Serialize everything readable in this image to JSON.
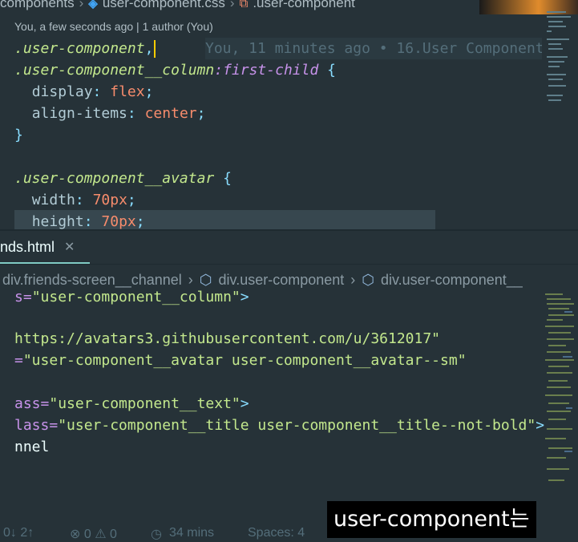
{
  "breadcrumb_top": {
    "folder": "components",
    "file": "user-component.css",
    "symbol": ".user-component"
  },
  "codelens_top": "You, a few seconds ago | 1 author (You)",
  "blame": "You, 11 minutes ago • 16.User Component",
  "top_code": {
    "l1_sel": ".user-component",
    "l1_punc": ",",
    "l2_sel": ".user-component__column",
    "l2_pseudo": ":first-child",
    "l2_brace": "{",
    "l3_prop": "display",
    "l3_val": "flex",
    "l4_prop": "align-items",
    "l4_val": "center",
    "l5_brace": "}",
    "l7_sel": ".user-component__avatar",
    "l7_brace": "{",
    "l8_prop": "width",
    "l8_val": "70px",
    "l9_prop": "height",
    "l9_val": "70px"
  },
  "tab": {
    "label": "nds.html",
    "close": "✕"
  },
  "breadcrumb_bottom": {
    "item1": "div.friends-screen__channel",
    "item2": "div.user-component",
    "item3": "div.user-component__"
  },
  "bottom_code": {
    "l1_attr": "s=",
    "l1_str": "\"user-component__column\"",
    "l1_punc": ">",
    "l2_str": "https://avatars3.githubusercontent.com/u/3612017\"",
    "l3_attr": "=",
    "l3_str": "\"user-component__avatar user-component__avatar--sm\"",
    "l4_attr": "ass=",
    "l4_str": "\"user-component__text\"",
    "l4_punc": ">",
    "l5_attr": "lass=",
    "l5_str": "\"user-component__title user-component__title--not-bold\"",
    "l5_punc": ">",
    "l6_text": "nnel"
  },
  "status": {
    "sync": "0↓ 2↑",
    "problems": "⊗ 0 ⚠ 0",
    "time": "34 mins",
    "spaces": "Spaces: 4"
  },
  "subtitle": "user-component는"
}
